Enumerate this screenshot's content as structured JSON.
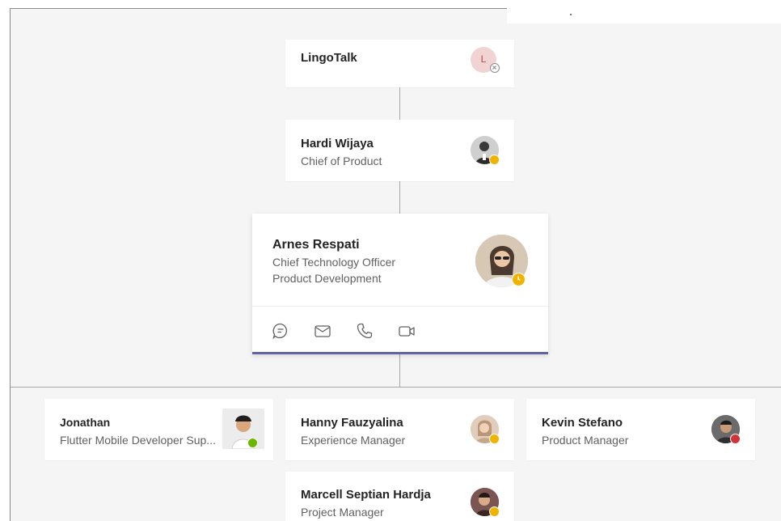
{
  "org": {
    "name": "LingoTalk",
    "initial": "L"
  },
  "manager": {
    "name": "Hardi Wijaya",
    "title": "Chief of Product"
  },
  "focus": {
    "name": "Arnes Respati",
    "title": "Chief Technology Officer",
    "department": "Product Development",
    "actions": [
      "chat",
      "email",
      "call",
      "video-call"
    ]
  },
  "reports": [
    {
      "name": "Jonathan",
      "title": "Flutter Mobile Developer Sup...",
      "status": "available"
    },
    {
      "name": "Hanny Fauzyalina",
      "title": "Experience Manager",
      "status": "away"
    },
    {
      "name": "Kevin Stefano",
      "title": "Product Manager",
      "status": "busy"
    },
    {
      "name": "Marcell Septian Hardja",
      "title": "Project Manager",
      "status": "away"
    }
  ],
  "colors": {
    "accent": "#6264a7",
    "away": "#f0b400",
    "available": "#6bb700",
    "busy": "#d13438"
  }
}
